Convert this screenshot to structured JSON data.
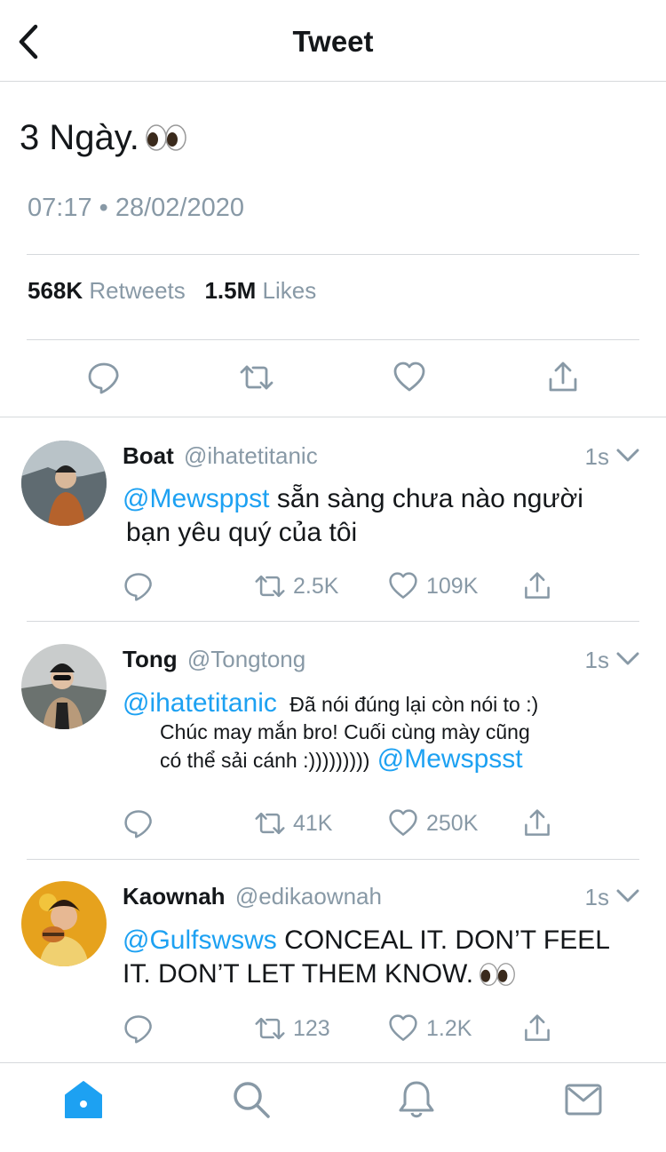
{
  "header": {
    "title": "Tweet"
  },
  "tweet": {
    "text": "3 Ngày.",
    "timestamp": "07:17 • 28/02/2020",
    "retweets_count": "568K",
    "retweets_label": "Retweets",
    "likes_count": "1.5M",
    "likes_label": "Likes"
  },
  "replies": [
    {
      "name": "Boat",
      "handle": "@ihatetitanic",
      "time": "1s",
      "mention": "@Mewsppst",
      "text_line1": "sẵn sàng chưa nào người",
      "text_line2": "bạn yêu quý của tôi",
      "retweets": "2.5K",
      "likes": "109K"
    },
    {
      "name": "Tong",
      "handle": "@Tongtong",
      "time": "1s",
      "mention": "@ihatetitanic",
      "text_line1": "Đã nói đúng lại còn nói to :)",
      "text_line2": "Chúc may mắn bro! Cuối cùng mày cũng",
      "text_line3": "có thể sải cánh :)))))))))",
      "mention2": "@Mewspsst",
      "retweets": "41K",
      "likes": "250K"
    },
    {
      "name": "Kaownah",
      "handle": "@edikaownah",
      "time": "1s",
      "mention": "@Gulfswsws",
      "text_line1": "CONCEAL IT. DON’T FEEL",
      "text_line2": "IT. DON’T LET THEM KNOW.",
      "retweets": "123",
      "likes": "1.2K"
    }
  ],
  "colors": {
    "accent": "#1da1f2",
    "muted": "#8899a6",
    "text": "#14171a",
    "divider": "#d6d9dc"
  },
  "icons": [
    "back-arrow-icon",
    "reply-icon",
    "retweet-icon",
    "like-icon",
    "share-icon",
    "chevron-down-icon",
    "eyes-emoji-icon",
    "home-icon",
    "search-icon",
    "notifications-icon",
    "messages-icon"
  ]
}
